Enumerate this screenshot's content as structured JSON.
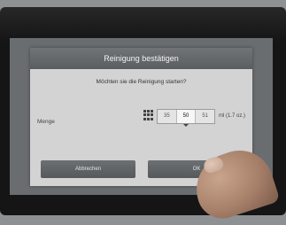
{
  "dialog": {
    "title": "Reinigung bestätigen",
    "question": "Möchten sie die Reinigung starten?",
    "quantity_label": "Menge",
    "stepper_values": [
      "35",
      "50",
      "51"
    ],
    "selected_value": "50",
    "unit": "ml (1.7 oz.)",
    "cancel_label": "Abbrechen",
    "ok_label": "OK"
  },
  "colors": {
    "dialog_background": "#d2d3d2",
    "title_bar": "#5a5e61",
    "button": "#5f6366"
  },
  "icons": {
    "keypad": "keypad-icon"
  }
}
